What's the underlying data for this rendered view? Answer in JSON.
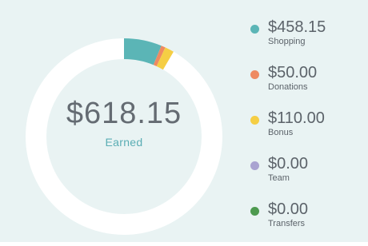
{
  "total": {
    "value": "$618.15",
    "label": "Earned"
  },
  "legend": [
    {
      "value": "$458.15",
      "label": "Shopping",
      "color": "#5bb5b6",
      "icon": "circle-dot"
    },
    {
      "value": "$50.00",
      "label": "Donations",
      "color": "#ee8a62",
      "icon": "circle-dot"
    },
    {
      "value": "$110.00",
      "label": "Bonus",
      "color": "#f5ce44",
      "icon": "circle-dot"
    },
    {
      "value": "$0.00",
      "label": "Team",
      "color": "#a9a3d1",
      "icon": "circle-dot"
    },
    {
      "value": "$0.00",
      "label": "Transfers",
      "color": "#4d9a4f",
      "icon": "circle-dot"
    }
  ],
  "chart_data": {
    "type": "pie",
    "categories": [
      "Shopping",
      "Donations",
      "Bonus",
      "Team",
      "Transfers"
    ],
    "values": [
      458.15,
      50.0,
      110.0,
      0.0,
      0.0
    ],
    "colors": [
      "#5bb5b6",
      "#ee8a62",
      "#f5ce44",
      "#a9a3d1",
      "#4d9a4f"
    ],
    "track_color": "#ffffff",
    "visible_segment_fractions": [
      0.062,
      0.007,
      0.015,
      0,
      0
    ]
  }
}
